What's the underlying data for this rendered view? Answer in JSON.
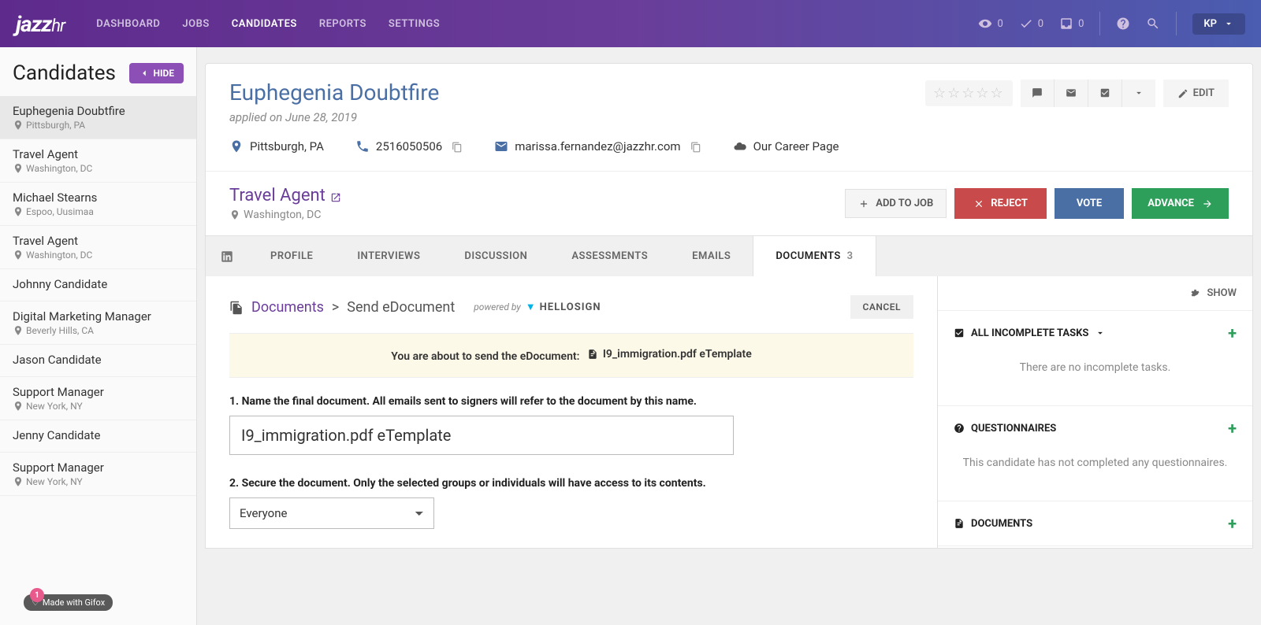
{
  "nav": {
    "logo": "jazzhr",
    "items": [
      "DASHBOARD",
      "JOBS",
      "CANDIDATES",
      "REPORTS",
      "SETTINGS"
    ],
    "stats": {
      "views": "0",
      "tasks": "0",
      "inbox": "0"
    },
    "user": "KP"
  },
  "sidebar": {
    "title": "Candidates",
    "hide": "HIDE",
    "items": [
      {
        "name": "Euphegenia Doubtfire",
        "loc": "Pittsburgh, PA"
      },
      {
        "name": "Travel Agent",
        "loc": "Washington, DC"
      },
      {
        "name": "Michael Stearns",
        "loc": "Espoo, Uusimaa"
      },
      {
        "name": "Travel Agent",
        "loc": "Washington, DC"
      },
      {
        "name": "Johnny Candidate",
        "loc": ""
      },
      {
        "name": "Digital Marketing Manager",
        "loc": "Beverly Hills, CA"
      },
      {
        "name": "Jason Candidate",
        "loc": ""
      },
      {
        "name": "Support Manager",
        "loc": "New York, NY"
      },
      {
        "name": "Jenny Candidate",
        "loc": ""
      },
      {
        "name": "Support Manager",
        "loc": "New York, NY"
      }
    ]
  },
  "candidate": {
    "name": "Euphegenia Doubtfire",
    "applied": "applied on June 28, 2019",
    "location": "Pittsburgh, PA",
    "phone": "2516050506",
    "email": "marissa.fernandez@jazzhr.com",
    "source": "Our Career Page",
    "edit": "EDIT"
  },
  "job": {
    "title": "Travel Agent",
    "loc": "Washington, DC",
    "add": "ADD TO JOB",
    "reject": "REJECT",
    "vote": "VOTE",
    "advance": "ADVANCE"
  },
  "tabs": {
    "items": [
      "PROFILE",
      "INTERVIEWS",
      "DISCUSSION",
      "ASSESSMENTS",
      "EMAILS",
      "DOCUMENTS"
    ],
    "docs_count": "3"
  },
  "doc": {
    "bc_link": "Documents",
    "bc_page": "Send eDocument",
    "powered": "powered by",
    "hs": "HELLOSIGN",
    "cancel": "CANCEL",
    "banner_pre": "You are about to send the eDocument:",
    "banner_file": "I9_immigration.pdf eTemplate",
    "step1": "1. Name the final document. All emails sent to signers will refer to the document by this name.",
    "name_value": "I9_immigration.pdf eTemplate",
    "step2": "2. Secure the document. Only the selected groups or individuals will have access to its contents.",
    "secure_value": "Everyone"
  },
  "side": {
    "show": "SHOW",
    "tasks_title": "ALL INCOMPLETE TASKS",
    "tasks_empty": "There are no incomplete tasks.",
    "q_title": "QUESTIONNAIRES",
    "q_empty": "This candidate has not completed any questionnaires.",
    "docs_title": "DOCUMENTS"
  },
  "gifox": {
    "badge": "1",
    "text": "Made with Gifox"
  }
}
